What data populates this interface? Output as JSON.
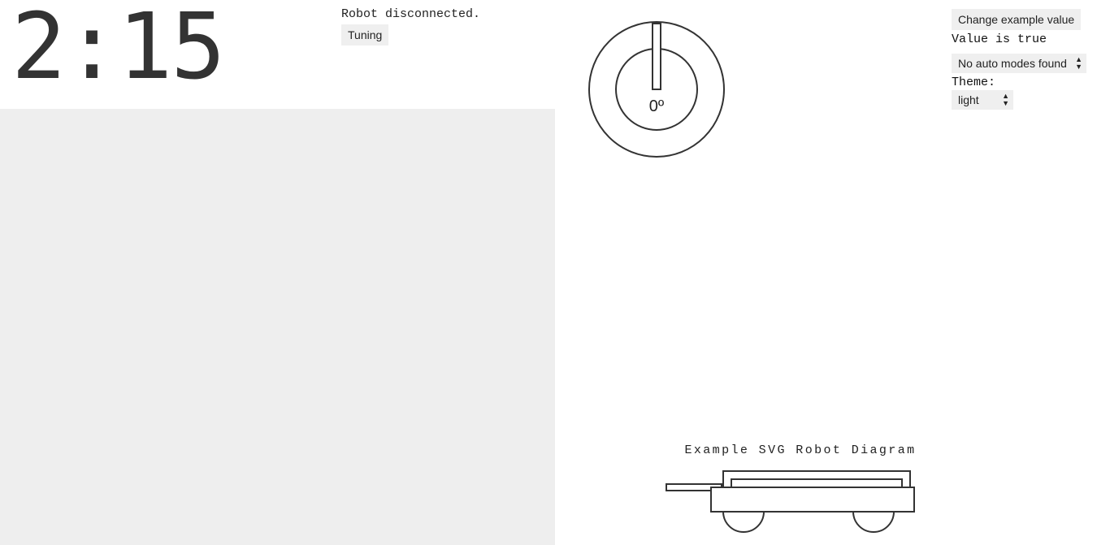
{
  "timer": {
    "text": "2:15"
  },
  "robot": {
    "status": "Robot disconnected."
  },
  "buttons": {
    "tuning": "Tuning",
    "change_example_value": "Change example value"
  },
  "example": {
    "value_text": "Value is true"
  },
  "auto_modes": {
    "selected": "No auto modes found"
  },
  "theme": {
    "label": "Theme:",
    "selected": "light"
  },
  "gyro": {
    "value_text": "0º",
    "angle_deg": 0
  },
  "diagram": {
    "title": "Example SVG Robot Diagram"
  },
  "icons": {
    "select_arrows": "up-down-arrows-icon"
  }
}
